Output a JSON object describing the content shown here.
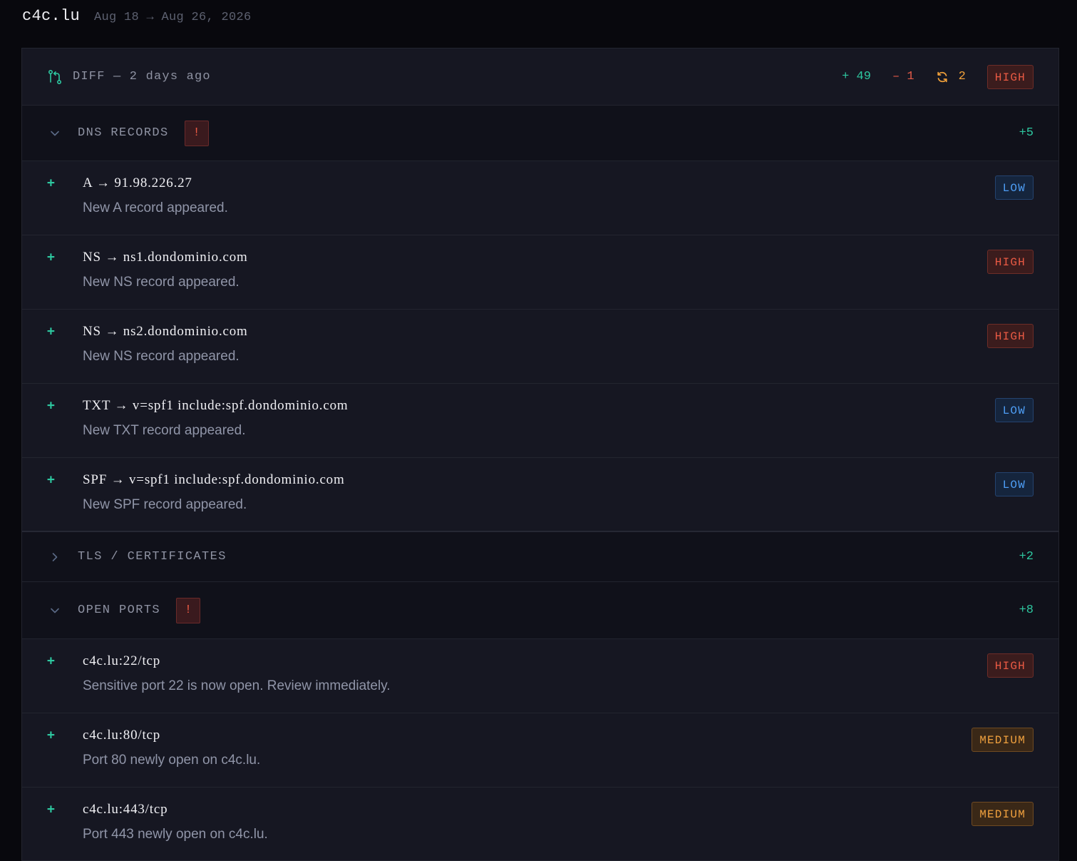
{
  "header": {
    "domain": "c4c.lu",
    "date_range": "Aug 18 → Aug 26, 2026"
  },
  "diff": {
    "title": "DIFF — 2 days ago",
    "added": "+ 49",
    "removed": "– 1",
    "changed": "2",
    "severity": "HIGH",
    "icon": "git-compare-icon",
    "changed_icon": "refresh-icon"
  },
  "colors": {
    "added": "#2ec8a0",
    "removed": "#e25a48",
    "changed": "#f0a03a",
    "high": "#ea5a44",
    "low": "#4e9ef5",
    "medium": "#efa03e"
  },
  "sections": {
    "dns": {
      "title": "DNS RECORDS",
      "alert": "!",
      "count": "+5",
      "expanded": true,
      "items": [
        {
          "key": "A → 91.98.226.27",
          "desc": "New A record appeared.",
          "severity": "LOW"
        },
        {
          "key": "NS → ns1.dondominio.com",
          "desc": "New NS record appeared.",
          "severity": "HIGH"
        },
        {
          "key": "NS → ns2.dondominio.com",
          "desc": "New NS record appeared.",
          "severity": "HIGH"
        },
        {
          "key": "TXT → v=spf1 include:spf.dondominio.com",
          "desc": "New TXT record appeared.",
          "severity": "LOW"
        },
        {
          "key": "SPF → v=spf1 include:spf.dondominio.com",
          "desc": "New SPF record appeared.",
          "severity": "LOW"
        }
      ]
    },
    "tls": {
      "title": "TLS / CERTIFICATES",
      "count": "+2",
      "expanded": false
    },
    "ports": {
      "title": "OPEN PORTS",
      "alert": "!",
      "count": "+8",
      "expanded": true,
      "items": [
        {
          "key": "c4c.lu:22/tcp",
          "desc": "Sensitive port 22 is now open. Review immediately.",
          "severity": "HIGH"
        },
        {
          "key": "c4c.lu:80/tcp",
          "desc": "Port 80 newly open on c4c.lu.",
          "severity": "MEDIUM"
        },
        {
          "key": "c4c.lu:443/tcp",
          "desc": "Port 443 newly open on c4c.lu.",
          "severity": "MEDIUM"
        }
      ]
    }
  },
  "item_marker": "+"
}
